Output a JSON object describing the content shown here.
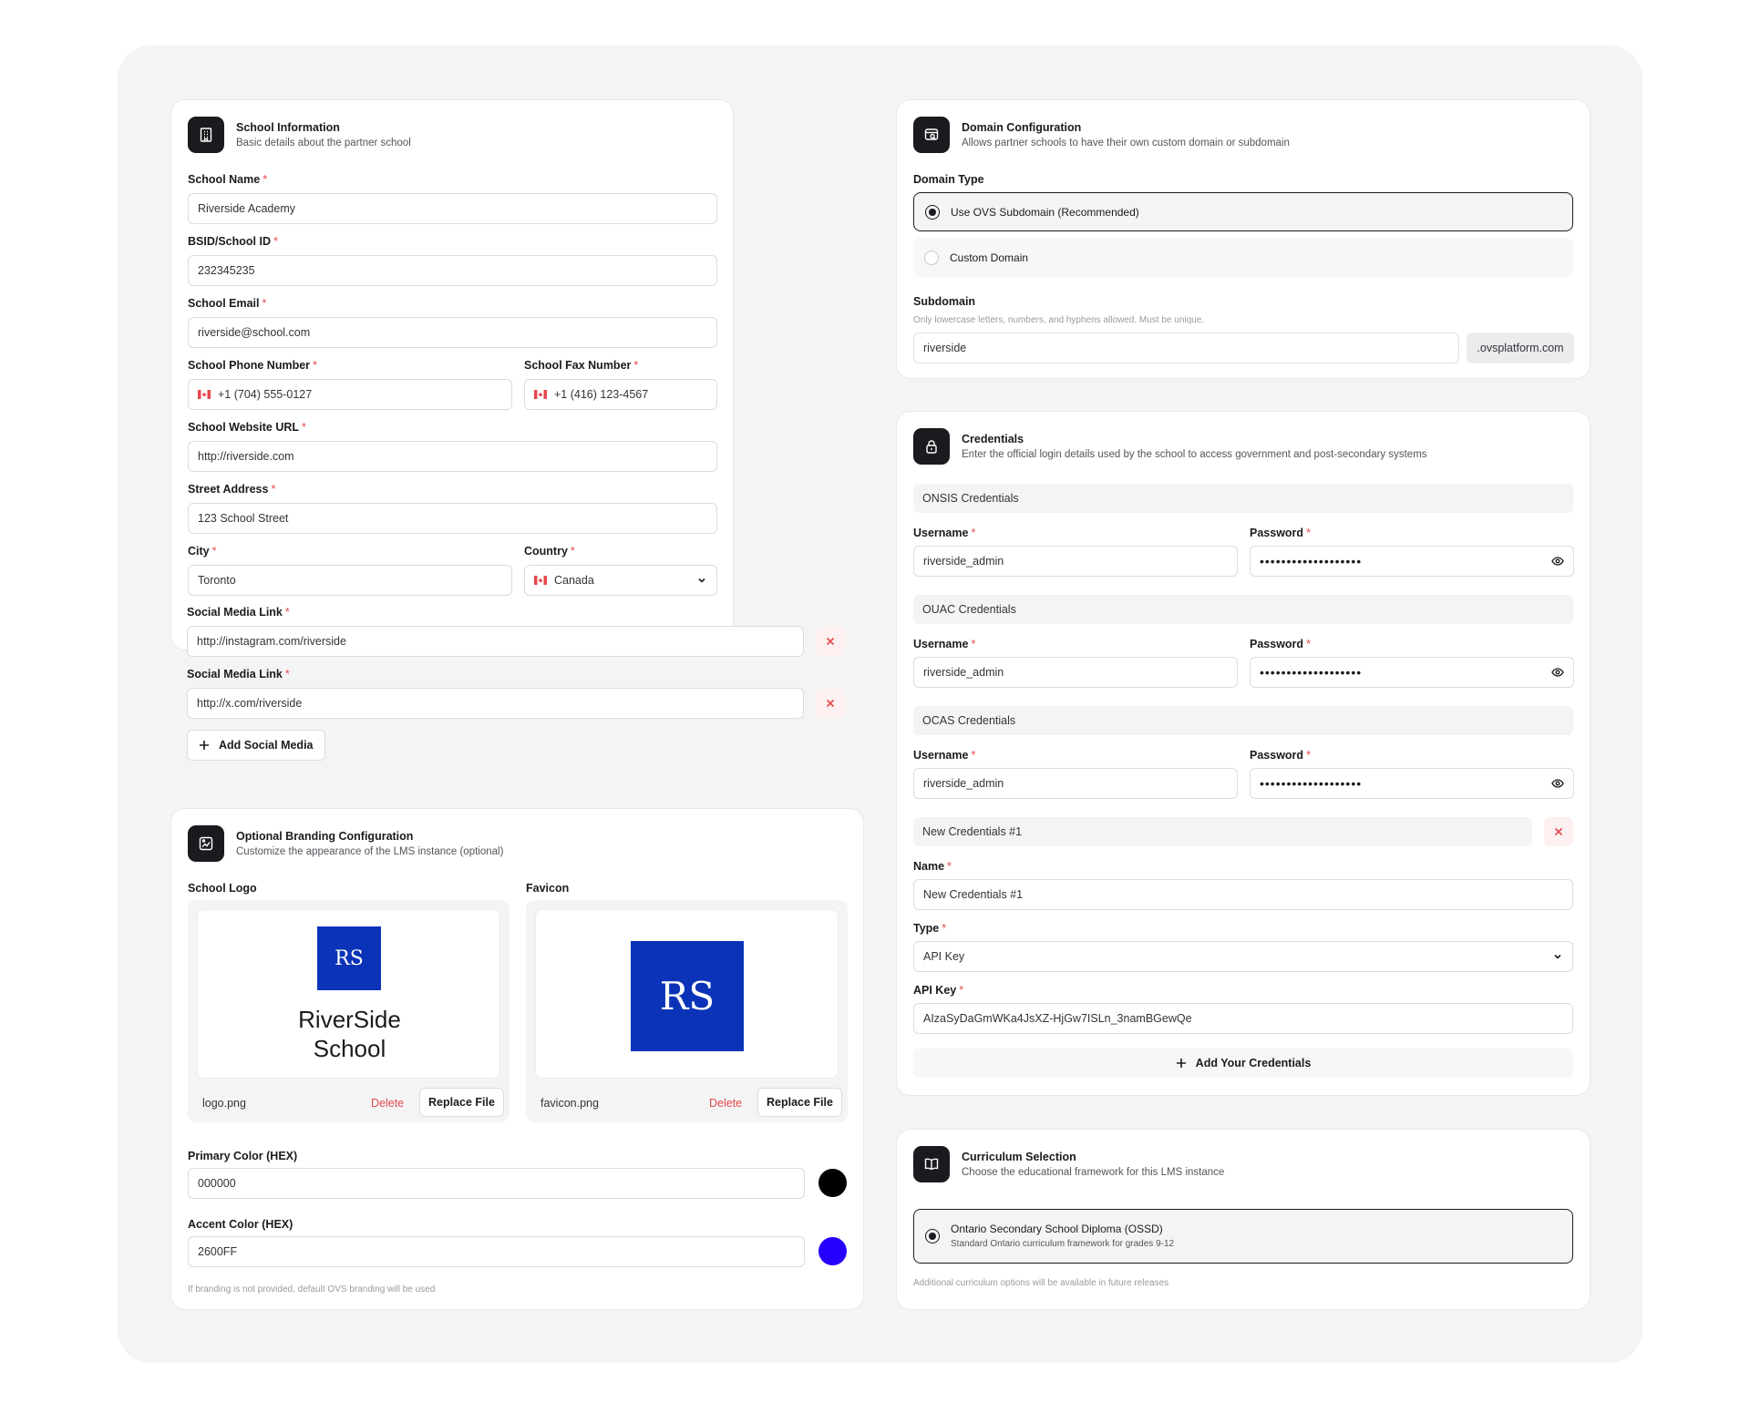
{
  "school_info": {
    "title": "School Information",
    "subtitle": "Basic details about the partner school",
    "icon": "building-icon",
    "fields": {
      "school_name": {
        "label": "School Name",
        "value": "Riverside Academy"
      },
      "bsid": {
        "label": "BSID/School ID",
        "value": "232345235"
      },
      "email": {
        "label": "School Email",
        "value": "riverside@school.com"
      },
      "phone": {
        "label": "School Phone Number",
        "value": "+1 (704) 555-0127"
      },
      "fax": {
        "label": "School Fax Number",
        "value": "+1 (416) 123-4567"
      },
      "website": {
        "label": "School Website URL",
        "value": "http://riverside.com"
      },
      "street": {
        "label": "Street Address",
        "value": "123 School Street"
      },
      "city": {
        "label": "City",
        "value": "Toronto"
      },
      "country": {
        "label": "Country",
        "value": "Canada"
      },
      "social1": {
        "label": "Social Media Link",
        "value": "http://instagram.com/riverside"
      },
      "social2": {
        "label": "Social Media Link",
        "value": "http://x.com/riverside"
      }
    },
    "required_mark": "*",
    "add_social_label": "Add Social Media"
  },
  "branding": {
    "title": "Optional Branding Configuration",
    "subtitle": "Customize the appearance of the LMS instance (optional)",
    "logo_label": "School Logo",
    "favicon_label": "Favicon",
    "logo_initials": "RS",
    "logo_name_line1": "RiverSide",
    "logo_name_line2": "School",
    "favicon_initials": "RS",
    "logo_file": "logo.png",
    "favicon_file": "favicon.png",
    "delete_label": "Delete",
    "replace_label": "Replace File",
    "primary_label": "Primary Color (HEX)",
    "primary_value": "000000",
    "accent_label": "Accent Color (HEX)",
    "accent_value": "2600FF",
    "note": "If branding is not provided, default OVS branding will be used",
    "colors": {
      "primary": "#000000",
      "accent": "#2600FF",
      "logo_bg": "#0B33B8"
    }
  },
  "domain": {
    "title": "Domain Configuration",
    "subtitle": "Allows partner schools to have their own custom domain or subdomain",
    "type_label": "Domain Type",
    "option_subdomain": "Use OVS Subdomain (Recommended)",
    "option_custom": "Custom Domain",
    "subdomain_label": "Subdomain",
    "subdomain_help": "Only lowercase letters, numbers, and hyphens allowed. Must be unique.",
    "subdomain_value": "riverside",
    "suffix": ".ovsplatform.com"
  },
  "credentials": {
    "title": "Credentials",
    "subtitle": "Enter the official login details used by the school to access government and post-secondary systems",
    "username_label": "Username",
    "password_label": "Password",
    "groups": [
      {
        "name": "ONSIS Credentials",
        "username": "riverside_admin",
        "password": "•••••••••••••••••••"
      },
      {
        "name": "OUAC Credentials",
        "username": "riverside_admin",
        "password": "•••••••••••••••••••"
      },
      {
        "name": "OCAS Credentials",
        "username": "riverside_admin",
        "password": "•••••••••••••••••••"
      }
    ],
    "new_group": {
      "name": "New Credentials #1",
      "name_label": "Name",
      "name_value": "New Credentials #1",
      "type_label": "Type",
      "type_value": "API Key",
      "key_label": "API Key",
      "key_value": "AIzaSyDaGmWKa4JsXZ-HjGw7ISLn_3namBGewQe"
    },
    "add_label": "Add Your Credentials"
  },
  "curriculum": {
    "title": "Curriculum Selection",
    "subtitle": "Choose the educational framework for this LMS instance",
    "option_title": "Ontario Secondary School Diploma (OSSD)",
    "option_sub": "Standard Ontario curriculum framework for grades 9-12",
    "note": "Additional curriculum options will be available in future releases"
  }
}
